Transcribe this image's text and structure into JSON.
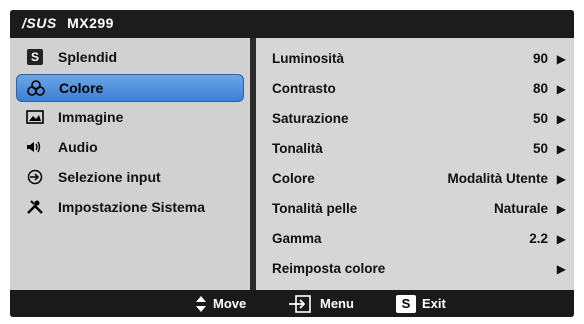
{
  "title": {
    "logo": "/SUS",
    "model": "MX299"
  },
  "menu": [
    {
      "label": "Splendid",
      "icon": "splendid-s-icon"
    },
    {
      "label": "Colore",
      "icon": "color-palette-icon",
      "selected": true
    },
    {
      "label": "Immagine",
      "icon": "image-icon"
    },
    {
      "label": "Audio",
      "icon": "speaker-icon"
    },
    {
      "label": "Selezione input",
      "icon": "input-arrow-icon"
    },
    {
      "label": "Impostazione Sistema",
      "icon": "tools-icon"
    }
  ],
  "settings": [
    {
      "name": "Luminosità",
      "value": "90"
    },
    {
      "name": "Contrasto",
      "value": "80"
    },
    {
      "name": "Saturazione",
      "value": "50"
    },
    {
      "name": "Tonalità",
      "value": "50"
    },
    {
      "name": "Colore",
      "value": "Modalità Utente"
    },
    {
      "name": "Tonalità pelle",
      "value": "Naturale"
    },
    {
      "name": "Gamma",
      "value": "2.2"
    },
    {
      "name": "Reimposta colore",
      "value": ""
    }
  ],
  "footer": {
    "move": "Move",
    "menu": "Menu",
    "exit_key": "S",
    "exit": "Exit"
  },
  "colors": {
    "highlight": "#4f8fdc",
    "bg_dark": "#1c1c1c"
  }
}
